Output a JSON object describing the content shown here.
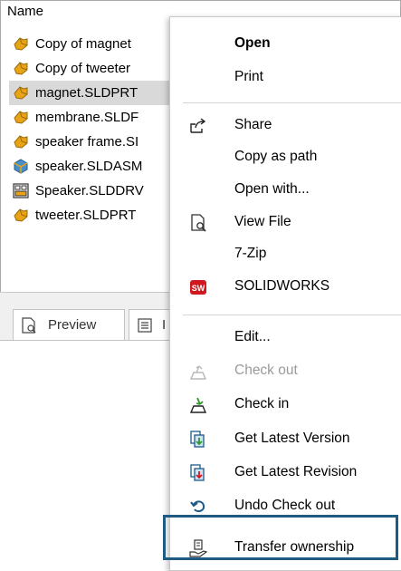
{
  "file_list": {
    "column_header": "Name",
    "files": [
      {
        "name": "Copy of magnet",
        "icon": "part-icon"
      },
      {
        "name": "Copy of tweeter",
        "icon": "part-icon"
      },
      {
        "name": "magnet.SLDPRT",
        "icon": "part-icon",
        "selected": true
      },
      {
        "name": "membrane.SLDF",
        "icon": "part-icon"
      },
      {
        "name": "speaker frame.SI",
        "icon": "part-icon"
      },
      {
        "name": "speaker.SLDASM",
        "icon": "assembly-icon"
      },
      {
        "name": "Speaker.SLDDRV",
        "icon": "drawing-icon"
      },
      {
        "name": "tweeter.SLDPRT",
        "icon": "part-icon"
      }
    ]
  },
  "lower_pane": {
    "tabs": [
      {
        "label": "Preview",
        "icon": "preview-icon"
      },
      {
        "label": "I",
        "icon": "bom-icon"
      }
    ]
  },
  "context_menu": {
    "items": [
      {
        "label": "Open",
        "bold": true
      },
      {
        "label": "Print"
      },
      {
        "label": "Share",
        "icon": "share-icon"
      },
      {
        "label": "Copy as path"
      },
      {
        "label": "Open with..."
      },
      {
        "label": "View File",
        "icon": "view-file-icon"
      },
      {
        "label": "7-Zip"
      },
      {
        "label": "SOLIDWORKS",
        "icon": "solidworks-icon"
      },
      {
        "label": "Edit..."
      },
      {
        "label": "Check out",
        "icon": "check-out-icon",
        "disabled": true
      },
      {
        "label": "Check in",
        "icon": "check-in-icon"
      },
      {
        "label": "Get Latest Version",
        "icon": "get-latest-version-icon"
      },
      {
        "label": "Get Latest Revision",
        "icon": "get-latest-revision-icon"
      },
      {
        "label": "Undo Check out",
        "icon": "undo-check-out-icon"
      },
      {
        "label": "Transfer ownership",
        "icon": "transfer-ownership-icon",
        "highlighted": true
      }
    ]
  },
  "colors": {
    "selection": "#d9d9d9",
    "highlight_border": "#1f5a82",
    "part_icon": "#e8a317",
    "assembly_icon": "#4a90c8",
    "solidworks_red": "#d0191f",
    "disabled_text": "#9a9a9a"
  }
}
